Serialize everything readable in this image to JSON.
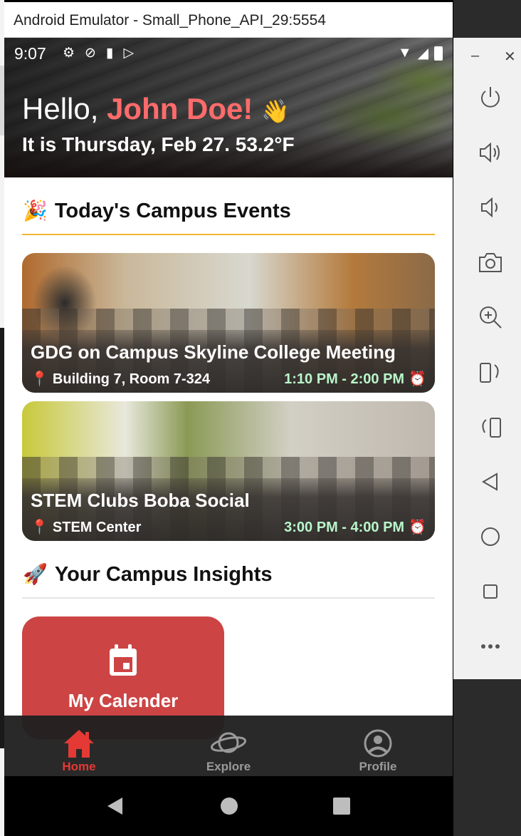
{
  "window": {
    "title": "Android Emulator - Small_Phone_API_29:5554"
  },
  "status_bar": {
    "time": "9:07",
    "left_icons": [
      "gear-icon",
      "location-off-icon",
      "sd-card-icon",
      "play-store-icon"
    ],
    "right_icons": [
      "wifi-icon",
      "signal-icon",
      "battery-icon"
    ]
  },
  "hero": {
    "greeting_prefix": "Hello, ",
    "user_name": "John Doe!",
    "wave": "👋",
    "date_weather": "It is Thursday, Feb 27. 53.2°F"
  },
  "events_section": {
    "emoji": "🎉",
    "title": "Today's Campus Events",
    "events": [
      {
        "title": "GDG on Campus Skyline College Meeting",
        "location": "Building 7, Room 7-324",
        "time": "1:10 PM - 2:00 PM"
      },
      {
        "title": "STEM Clubs Boba Social",
        "location": "STEM Center",
        "time": "3:00 PM - 4:00 PM"
      }
    ]
  },
  "insights_section": {
    "emoji": "🚀",
    "title": "Your Campus Insights",
    "cards": [
      {
        "label": "My Calender",
        "icon": "calendar-icon",
        "color": "#cc4444"
      }
    ]
  },
  "bottom_nav": {
    "items": [
      {
        "label": "Home",
        "icon": "home-icon",
        "active": true
      },
      {
        "label": "Explore",
        "icon": "planet-icon",
        "active": false
      },
      {
        "label": "Profile",
        "icon": "profile-icon",
        "active": false
      }
    ]
  },
  "colors": {
    "accent_red": "#e53935",
    "name_red": "#ff6b6b",
    "divider_gold": "#f2b632",
    "time_green": "#b9f6ca"
  },
  "emulator_panel": {
    "controls": [
      "power-icon",
      "volume-up-icon",
      "volume-down-icon",
      "camera-icon",
      "zoom-in-icon",
      "rotate-left-icon",
      "rotate-right-icon",
      "back-icon",
      "home-icon",
      "overview-icon",
      "more-icon"
    ]
  }
}
